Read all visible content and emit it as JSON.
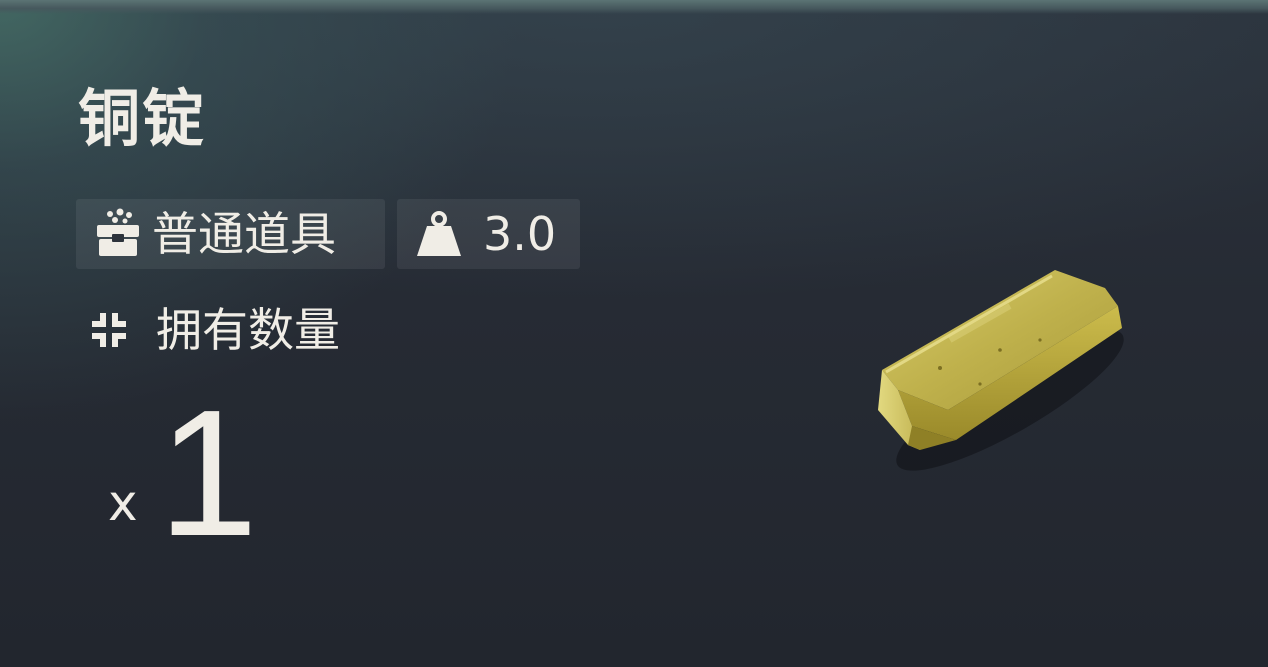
{
  "item": {
    "name": "铜锭",
    "rarity_label": "普通道具",
    "rarity_icon": "chest-icon",
    "weight_value": "3.0",
    "weight_icon": "weight-icon",
    "owned_label": "拥有数量",
    "owned_icon": "crosshair-icon",
    "quantity_prefix": "x",
    "quantity_value": "1",
    "image_icon": "ingot-icon"
  },
  "colors": {
    "text": "#f0ede6",
    "background": "#262b34",
    "accent_teal": "#466e68",
    "ingot_gold": "#c9b24a"
  }
}
